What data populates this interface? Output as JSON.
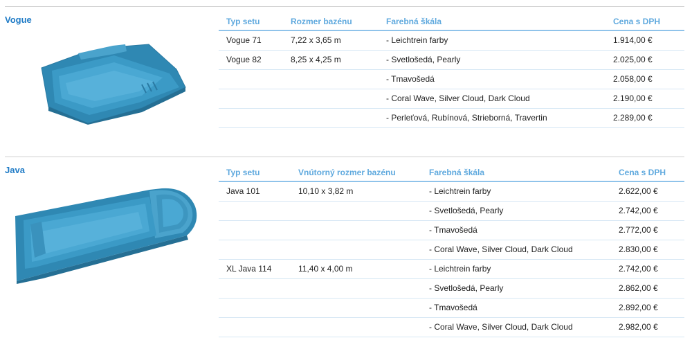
{
  "sections": [
    {
      "title": "Vogue",
      "image_icon": "pool-vogue-image",
      "headers": [
        "Typ setu",
        "Rozmer bazénu",
        "Farebná škála",
        "Cena s DPH"
      ],
      "rows": [
        {
          "type": "Vogue 71",
          "size": "7,22 x 3,65 m",
          "color": "- Leichtrein farby",
          "price": "1.914,00 €"
        },
        {
          "type": "Vogue 82",
          "size": "8,25 x 4,25 m",
          "color": "- Svetlošedá, Pearly",
          "price": "2.025,00 €"
        },
        {
          "type": "",
          "size": "",
          "color": "- Tmavošedá",
          "price": "2.058,00 €"
        },
        {
          "type": "",
          "size": "",
          "color": "- Coral Wave, Silver Cloud, Dark Cloud",
          "price": "2.190,00 €"
        },
        {
          "type": "",
          "size": "",
          "color": "- Perleťová, Rubínová, Strieborná, Travertin",
          "price": "2.289,00 €"
        }
      ]
    },
    {
      "title": "Java",
      "image_icon": "pool-java-image",
      "headers": [
        "Typ setu",
        "Vnútorný rozmer bazénu",
        "Farebná škála",
        "Cena s DPH"
      ],
      "rows": [
        {
          "type": "Java 101",
          "size": "10,10 x 3,82 m",
          "color": "- Leichtrein farby",
          "price": "2.622,00 €"
        },
        {
          "type": "",
          "size": "",
          "color": "- Svetlošedá, Pearly",
          "price": "2.742,00 €"
        },
        {
          "type": "",
          "size": "",
          "color": "- Tmavošedá",
          "price": "2.772,00 €"
        },
        {
          "type": "",
          "size": "",
          "color": "- Coral Wave, Silver Cloud, Dark Cloud",
          "price": "2.830,00 €"
        },
        {
          "type": "XL Java 114",
          "size": "11,40 x 4,00 m",
          "color": "- Leichtrein farby",
          "price": "2.742,00 €"
        },
        {
          "type": "",
          "size": "",
          "color": "- Svetlošedá, Pearly",
          "price": "2.862,00 €"
        },
        {
          "type": "",
          "size": "",
          "color": "- Tmavošedá",
          "price": "2.892,00 €"
        },
        {
          "type": "",
          "size": "",
          "color": "- Coral Wave, Silver Cloud, Dark Cloud",
          "price": "2.982,00 €"
        }
      ]
    }
  ],
  "colors": {
    "title": "#1f7bc6",
    "header": "#5fa9de",
    "pool": "#3b93bd"
  }
}
